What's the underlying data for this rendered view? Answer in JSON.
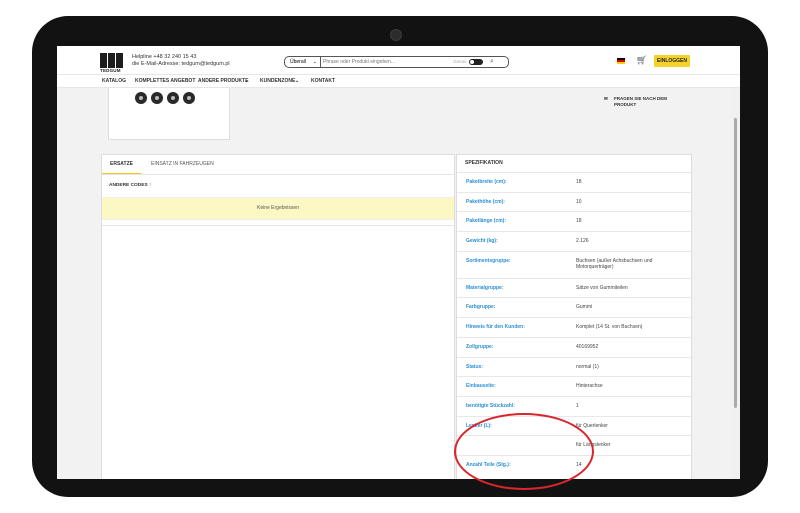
{
  "header": {
    "logo_text": "TEDGUM",
    "helpline": "Helpline +48 32 240 15 43",
    "email": "die E-Mail-Adresse: tedgum@tedgum.pl",
    "search_select": "Überall",
    "search_placeholder": "Phrase oder Produkt eingeben...",
    "toggle_label": "Genau",
    "login_label": "EINLOGGEN",
    "icons": {
      "search": "search-icon",
      "cart": "cart-icon",
      "flag": "de-flag-icon"
    }
  },
  "nav": [
    "KATALOG",
    "KOMPLETTES ANGEBOT",
    "ANDERE PRODUKTE",
    "KUNDENZONE",
    "KONTAKT"
  ],
  "product": {
    "ask_label": "FRAGEN SIE NACH DEM PRODUKT"
  },
  "left": {
    "tab_active": "ERSATZE",
    "tab_other": "EINSATZ IN FAHRZEUGEN",
    "other_codes": "ANDERE CODES",
    "no_results": "Keine Ergebnissen"
  },
  "spec": {
    "title": "SPEZIFIKATION",
    "rows": [
      {
        "k": "Paketbreite (cm):",
        "v": "18"
      },
      {
        "k": "Pakethöhe (cm):",
        "v": "10"
      },
      {
        "k": "Paketlänge (cm):",
        "v": "18"
      },
      {
        "k": "Gewicht (kg):",
        "v": "2.126"
      },
      {
        "k": "Sortimentsgruppe:",
        "v": "Buchsen (außer Achsbuchsen und Motorquerträger)"
      },
      {
        "k": "Materialgruppe:",
        "v": "Sätze von Gummiteilen"
      },
      {
        "k": "Farbgruppe:",
        "v": "Gummi"
      },
      {
        "k": "Hinweis für den Kunden:",
        "v": "Komplet (14 St. von Buchsen)"
      },
      {
        "k": "Zollgruppe:",
        "v": "40169952"
      },
      {
        "k": "Status:",
        "v": "normal (1)"
      },
      {
        "k": "Einbauseite:",
        "v": "Hinterachse"
      },
      {
        "k": "benötigte Stückzahl:",
        "v": "1"
      },
      {
        "k": "Lenker (L):",
        "v": "für Querlenker"
      },
      {
        "k": "",
        "v": "für Längslenker"
      },
      {
        "k": "Anzahl Teile (Stg.):",
        "v": "14"
      }
    ]
  }
}
